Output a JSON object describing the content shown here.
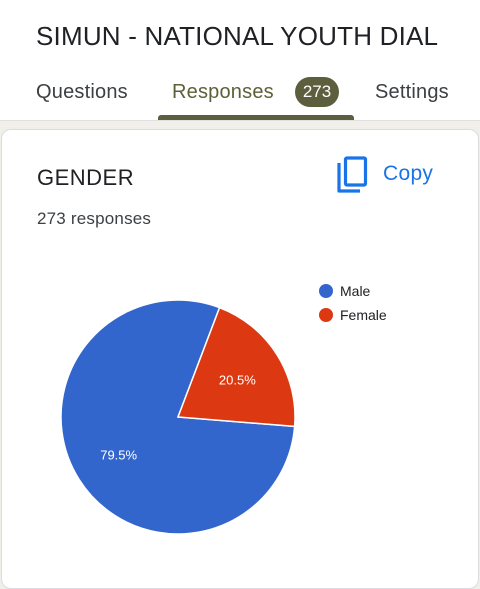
{
  "form": {
    "title": "SIMUN - NATIONAL YOUTH DIALOGUE"
  },
  "tabs": {
    "questions": "Questions",
    "responses": "Responses",
    "responses_count": "273",
    "settings": "Settings",
    "active": "responses"
  },
  "question": {
    "title": "GENDER",
    "copy_label": "Copy",
    "copy_icon": "copy-icon",
    "response_count_text": "273 responses"
  },
  "colors": {
    "accent": "#5d5e3e",
    "link": "#1a73e8",
    "male": "#3366cc",
    "female": "#dc3912"
  },
  "chart_data": {
    "type": "pie",
    "title": "",
    "legend_position": "right",
    "slices": [
      {
        "label": "Male",
        "value": 79.5,
        "display": "79.5%",
        "color": "#3366cc"
      },
      {
        "label": "Female",
        "value": 20.5,
        "display": "20.5%",
        "color": "#dc3912"
      }
    ]
  }
}
